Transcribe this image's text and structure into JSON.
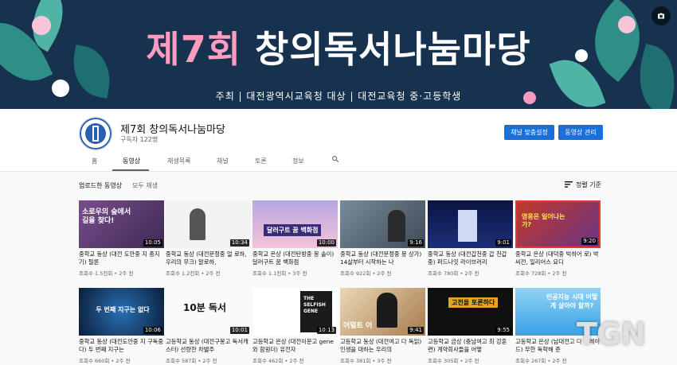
{
  "banner": {
    "title_part1": "제7회",
    "title_part2": "창의독서나눔마당",
    "subtitle": "주최  |  대전광역시교육청    대상  |  대전교육청 중·고등학생",
    "camera_icon": "camera-icon",
    "colors": {
      "bg": "#16324f",
      "title_pink": "#ff9cbf"
    }
  },
  "channel": {
    "name": "제7회 창의독서나눔마당",
    "subscribers": "구독자 122명",
    "customize_button": "채널 맞춤설정",
    "manage_button": "동영상 관리"
  },
  "tabs": [
    "홈",
    "동영상",
    "재생목록",
    "채널",
    "토론",
    "정보"
  ],
  "active_tab": "동영상",
  "search_icon": "search-icon",
  "section": {
    "title": "업로드한 동영상",
    "play_all": "모두 재생",
    "sort_label": "정렬 기준",
    "sort_icon": "sort-icon"
  },
  "videos": [
    {
      "title": "중학교 동상 (대전 도안중 지 종지기) 필론",
      "meta": "조회수 1.5천회 • 2주 전",
      "duration": "10:05",
      "thumb_text": "소로우의 숲에서 길을 찾다!"
    },
    {
      "title": "중학교 동상 (대전문정중 얼 로하, 우리의 무크) 알로하,",
      "meta": "조회수 1.2천회 • 2주 전",
      "duration": "10:34",
      "thumb_text": ""
    },
    {
      "title": "중학교 은상 (대전탄방중 몽 솔이) 달러구트 꿈 백화점",
      "meta": "조회수 1.1천회 • 3주 전",
      "duration": "10:00",
      "thumb_text": "달러구트 꿈 백화점"
    },
    {
      "title": "중학교 동상 (대전문정중 몽 상가) 14살부터 시작하는 나",
      "meta": "조회수 922회 • 2주 전",
      "duration": "9:16",
      "thumb_text": ""
    },
    {
      "title": "중학교 동상 (대전갑천중 갑 천갑중) 퍼드나잇 라이브러리",
      "meta": "조회수 780회 • 2주 전",
      "duration": "9:01",
      "thumb_text": ""
    },
    {
      "title": "중학교 은상 (대덕중 빅히어 로) 박씨전, 일리어스 요디",
      "meta": "조회수 728회 • 2주 전",
      "duration": "9:20",
      "thumb_text": "영웅은 일어나는가?"
    },
    {
      "title": "중학교 동상 (대전도안중 지 구독중다) 두 번째 지구는",
      "meta": "조회수 660회 • 2주 전",
      "duration": "10:06",
      "thumb_text": "두 번째 지구는 없다"
    },
    {
      "title": "고등학교 동상 (대전구봉고 독서캐스터) 선량한 차별주",
      "meta": "조회수 587회 • 2주 전",
      "duration": "10:01",
      "thumb_text": "10분 독서"
    },
    {
      "title": "고등학교 은상 (대전이문고 gene와 함원더) 유전자",
      "meta": "조회수 462회 • 2주 전",
      "duration": "10:13",
      "thumb_text": "THE SELFISH GENE"
    },
    {
      "title": "고등학교 동상 (대전여고 다 독읽) 인생을 대하는 우리의",
      "meta": "조회수 381회 • 3주 전",
      "duration": "9:41",
      "thumb_text": "어덜트 어"
    },
    {
      "title": "고등학교 금상 (충남여고 최 강훈련) 계약회사들을 어떻",
      "meta": "조회수 305회 • 2주 전",
      "duration": "9:55",
      "thumb_text": "고전을 토론하다"
    },
    {
      "title": "고등학교 은상 (남대전고 다 트레이드) 무한 독학해 준",
      "meta": "조회수 267회 • 2주 전",
      "duration": "",
      "thumb_text": "인공지능 시대 어떻게 살아야 할까?"
    }
  ],
  "watermark": "TGN"
}
